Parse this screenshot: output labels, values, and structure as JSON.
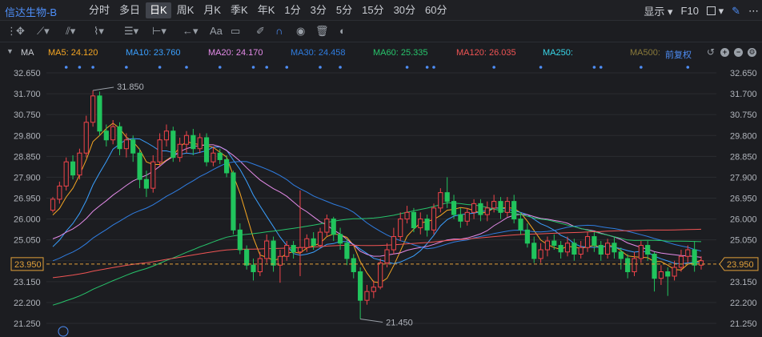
{
  "header": {
    "stock_name": "信达生物-B",
    "tabs": [
      {
        "label": "分时",
        "active": false
      },
      {
        "label": "多日",
        "active": false
      },
      {
        "label": "日K",
        "active": true
      },
      {
        "label": "周K",
        "active": false
      },
      {
        "label": "月K",
        "active": false
      },
      {
        "label": "季K",
        "active": false
      },
      {
        "label": "年K",
        "active": false
      },
      {
        "label": "1分",
        "active": false
      },
      {
        "label": "3分",
        "active": false
      },
      {
        "label": "5分",
        "active": false
      },
      {
        "label": "15分",
        "active": false
      },
      {
        "label": "30分",
        "active": false
      },
      {
        "label": "60分",
        "active": false
      }
    ],
    "display_label": "显示",
    "f10_label": "F10"
  },
  "toolbar": {
    "font_tool_label": "Aa"
  },
  "ma_legend": {
    "title": "MA",
    "items": [
      {
        "label": "MA5: 24.120",
        "color": "#f5a623"
      },
      {
        "label": "MA10: 23.760",
        "color": "#3aa0ff"
      },
      {
        "label": "MA20: 24.170",
        "color": "#e48be8"
      },
      {
        "label": "MA30: 24.458",
        "color": "#2f7de1"
      },
      {
        "label": "MA60: 25.335",
        "color": "#27c46b"
      },
      {
        "label": "MA120: 26.035",
        "color": "#f05454"
      },
      {
        "label": "MA250:",
        "color": "#38d6e8"
      },
      {
        "label": "MA500:",
        "color": "#8a7a3a"
      }
    ],
    "adjust_label": "前复权"
  },
  "colors": {
    "up": "#f0444a",
    "down": "#21c45d",
    "ma5": "#f5a623",
    "ma10": "#3aa0ff",
    "ma20": "#e48be8",
    "ma30": "#2f7de1",
    "ma60": "#27c46b",
    "ma120": "#f05454",
    "current_price": "#e2a13a",
    "event_dot": "#4e8ef7"
  },
  "chart_data": {
    "type": "candlestick",
    "y_ticks": [
      "32.650",
      "31.700",
      "30.750",
      "29.800",
      "28.850",
      "27.900",
      "26.950",
      "26.000",
      "25.050",
      "24.100",
      "23.150",
      "22.200",
      "21.250"
    ],
    "ylim": [
      21.25,
      32.65
    ],
    "current_price_label": "23.950",
    "current_price": 23.95,
    "high_annotation": "31.850",
    "high_value": 31.85,
    "low_annotation": "21.450",
    "low_value": 21.45,
    "candles": [
      [
        26.4,
        26.9,
        26.3,
        27.0
      ],
      [
        26.9,
        27.5,
        26.7,
        27.7
      ],
      [
        27.5,
        28.6,
        27.3,
        28.8
      ],
      [
        28.6,
        28.0,
        27.8,
        28.9
      ],
      [
        28.0,
        29.0,
        27.8,
        29.2
      ],
      [
        29.0,
        30.4,
        28.8,
        30.7
      ],
      [
        30.4,
        31.6,
        30.2,
        31.85
      ],
      [
        31.6,
        30.0,
        29.8,
        31.8
      ],
      [
        30.0,
        29.6,
        29.3,
        30.3
      ],
      [
        29.6,
        30.2,
        29.4,
        30.5
      ],
      [
        30.2,
        29.2,
        28.9,
        30.4
      ],
      [
        29.2,
        29.6,
        28.8,
        29.9
      ],
      [
        29.6,
        29.0,
        28.6,
        29.8
      ],
      [
        29.0,
        27.8,
        27.4,
        29.2
      ],
      [
        27.8,
        27.4,
        27.0,
        28.2
      ],
      [
        27.4,
        28.6,
        27.2,
        28.9
      ],
      [
        28.6,
        29.6,
        28.4,
        29.9
      ],
      [
        29.6,
        30.0,
        29.3,
        30.3
      ],
      [
        30.0,
        28.8,
        28.6,
        30.2
      ],
      [
        28.8,
        29.4,
        28.6,
        29.7
      ],
      [
        29.4,
        29.8,
        29.0,
        30.0
      ],
      [
        29.8,
        29.2,
        28.9,
        30.1
      ],
      [
        29.2,
        29.7,
        29.0,
        29.9
      ],
      [
        29.7,
        28.6,
        28.4,
        29.9
      ],
      [
        28.6,
        29.0,
        28.4,
        29.3
      ],
      [
        29.0,
        28.7,
        28.5,
        29.2
      ],
      [
        28.7,
        28.1,
        27.9,
        28.9
      ],
      [
        28.1,
        25.5,
        25.3,
        28.2
      ],
      [
        25.5,
        24.6,
        24.4,
        25.8
      ],
      [
        24.6,
        23.9,
        23.7,
        24.8
      ],
      [
        23.9,
        23.6,
        23.2,
        24.2
      ],
      [
        23.6,
        24.2,
        23.4,
        24.5
      ],
      [
        24.2,
        25.0,
        24.0,
        25.3
      ],
      [
        25.0,
        23.9,
        23.6,
        25.2
      ],
      [
        23.9,
        24.3,
        23.1,
        24.6
      ],
      [
        24.3,
        24.8,
        24.1,
        25.0
      ],
      [
        24.8,
        24.5,
        24.2,
        25.0
      ],
      [
        24.5,
        24.7,
        23.4,
        27.3
      ],
      [
        24.7,
        25.1,
        24.5,
        25.3
      ],
      [
        25.1,
        24.8,
        24.6,
        25.4
      ],
      [
        24.8,
        25.4,
        24.7,
        25.6
      ],
      [
        25.4,
        26.0,
        25.2,
        26.2
      ],
      [
        26.0,
        25.3,
        25.0,
        26.1
      ],
      [
        25.3,
        24.9,
        24.6,
        25.6
      ],
      [
        24.9,
        24.2,
        23.9,
        25.1
      ],
      [
        24.2,
        23.6,
        23.3,
        24.4
      ],
      [
        23.6,
        22.3,
        21.45,
        23.8
      ],
      [
        22.3,
        22.7,
        22.1,
        23.0
      ],
      [
        22.7,
        22.9,
        22.4,
        23.2
      ],
      [
        22.9,
        24.0,
        22.8,
        24.2
      ],
      [
        24.0,
        24.6,
        23.8,
        24.9
      ],
      [
        24.6,
        25.2,
        24.4,
        25.6
      ],
      [
        25.2,
        26.0,
        25.0,
        26.3
      ],
      [
        26.0,
        26.3,
        25.8,
        26.6
      ],
      [
        26.3,
        25.6,
        25.4,
        26.5
      ],
      [
        25.6,
        26.0,
        25.3,
        26.3
      ],
      [
        26.0,
        25.5,
        25.2,
        26.2
      ],
      [
        25.5,
        26.5,
        25.3,
        26.7
      ],
      [
        26.5,
        27.2,
        26.3,
        27.4
      ],
      [
        27.2,
        26.8,
        26.5,
        27.9
      ],
      [
        26.8,
        26.2,
        26.0,
        27.1
      ],
      [
        26.2,
        25.9,
        25.6,
        26.5
      ],
      [
        25.9,
        26.3,
        25.7,
        26.5
      ],
      [
        26.3,
        26.7,
        26.0,
        26.9
      ],
      [
        26.7,
        26.2,
        25.9,
        26.9
      ],
      [
        26.2,
        26.5,
        25.9,
        26.8
      ],
      [
        26.5,
        26.8,
        26.3,
        27.1
      ],
      [
        26.8,
        26.3,
        26.0,
        27.0
      ],
      [
        26.3,
        26.8,
        26.1,
        27.0
      ],
      [
        26.8,
        26.0,
        25.8,
        27.1
      ],
      [
        26.0,
        25.5,
        25.3,
        26.3
      ],
      [
        25.5,
        24.9,
        24.7,
        25.8
      ],
      [
        24.9,
        24.2,
        24.0,
        25.2
      ],
      [
        24.2,
        24.6,
        24.0,
        24.9
      ],
      [
        24.6,
        25.0,
        24.3,
        25.2
      ],
      [
        25.0,
        24.8,
        24.6,
        25.3
      ],
      [
        24.8,
        24.5,
        24.2,
        25.0
      ],
      [
        24.5,
        24.9,
        24.3,
        25.2
      ],
      [
        24.9,
        24.4,
        24.1,
        25.1
      ],
      [
        24.4,
        24.7,
        24.2,
        25.0
      ],
      [
        24.7,
        25.2,
        24.5,
        25.4
      ],
      [
        25.2,
        24.8,
        24.5,
        25.4
      ],
      [
        24.8,
        24.4,
        24.1,
        25.0
      ],
      [
        24.4,
        24.9,
        24.2,
        25.1
      ],
      [
        24.9,
        24.5,
        24.2,
        25.2
      ],
      [
        24.5,
        24.2,
        23.7,
        24.7
      ],
      [
        24.2,
        23.6,
        23.3,
        24.4
      ],
      [
        23.6,
        24.2,
        23.4,
        24.5
      ],
      [
        24.2,
        24.8,
        24.0,
        25.0
      ],
      [
        24.8,
        24.4,
        24.1,
        25.0
      ],
      [
        24.4,
        23.3,
        22.7,
        24.5
      ],
      [
        23.3,
        23.6,
        23.0,
        23.9
      ],
      [
        23.6,
        23.4,
        22.5,
        23.8
      ],
      [
        23.4,
        23.8,
        23.2,
        24.1
      ],
      [
        23.8,
        24.3,
        23.6,
        24.6
      ],
      [
        24.3,
        24.6,
        24.0,
        24.8
      ],
      [
        24.6,
        23.9,
        23.6,
        25.0
      ],
      [
        23.9,
        24.1,
        23.7,
        24.3
      ]
    ],
    "event_dot_indices": [
      2,
      4,
      6,
      11,
      16,
      20,
      25,
      30,
      32,
      35,
      40,
      43,
      53,
      56,
      57,
      66,
      73,
      81,
      82,
      88,
      95
    ]
  }
}
